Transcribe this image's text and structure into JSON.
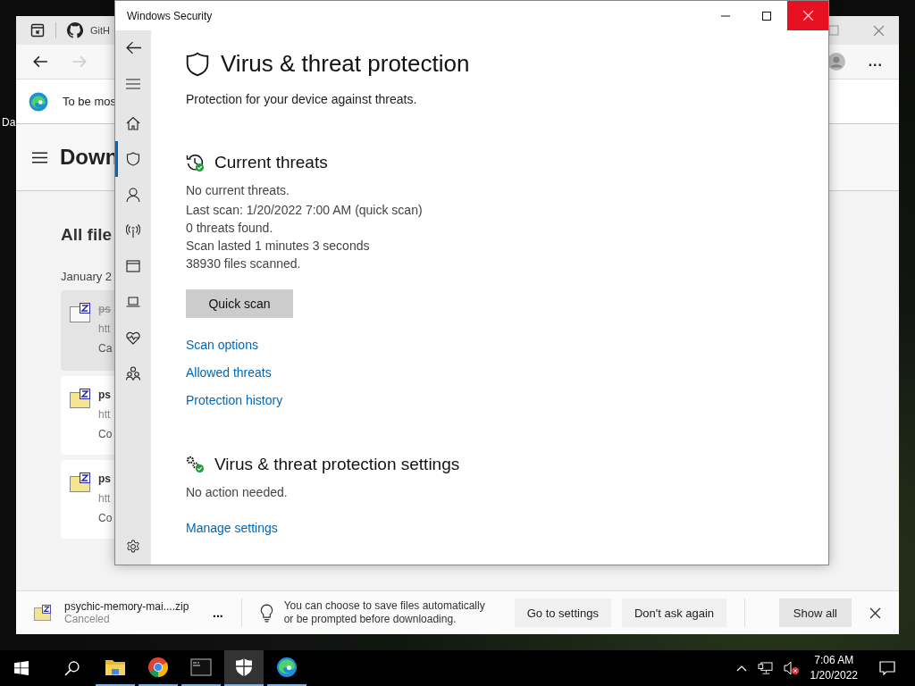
{
  "desktop": {
    "icon_label": "Da"
  },
  "browser": {
    "tab_title": "GitH",
    "more": "...",
    "info_text": "To be mos",
    "page_title": "Down",
    "section_title": "All file",
    "date_group": "January 2",
    "downloads": [
      {
        "name": "ps",
        "url": "htt",
        "status": "Ca",
        "selected": true,
        "canceled": true
      },
      {
        "name": "ps",
        "url": "htt",
        "status": "Co",
        "selected": false,
        "canceled": false
      },
      {
        "name": "ps",
        "url": "htt",
        "status": "Co",
        "selected": false,
        "canceled": false
      }
    ]
  },
  "download_bar": {
    "file": "psychic-memory-mai....zip",
    "status": "Canceled",
    "more": "...",
    "tip": "You can choose to save files automatically or be prompted before downloading.",
    "buttons": [
      "Go to settings",
      "Don't ask again"
    ],
    "show_all": "Show all"
  },
  "security": {
    "title": "Windows Security",
    "nav": [
      {
        "kind": "home",
        "selected": false
      },
      {
        "kind": "shield",
        "selected": true
      },
      {
        "kind": "account",
        "selected": false
      },
      {
        "kind": "network",
        "selected": false
      },
      {
        "kind": "app",
        "selected": false
      },
      {
        "kind": "device",
        "selected": false
      },
      {
        "kind": "health",
        "selected": false
      },
      {
        "kind": "family",
        "selected": false
      }
    ],
    "heading": "Virus & threat protection",
    "subtitle": "Protection for your device against threats.",
    "current_threats": {
      "title": "Current threats",
      "status": "No current threats.",
      "details": [
        "Last scan: 1/20/2022 7:00 AM (quick scan)",
        "0 threats found.",
        "Scan lasted 1 minutes 3 seconds",
        "38930 files scanned."
      ],
      "button": "Quick scan",
      "links": [
        "Scan options",
        "Allowed threats",
        "Protection history"
      ]
    },
    "settings": {
      "title": "Virus & threat protection settings",
      "status": "No action needed.",
      "link": "Manage settings"
    }
  },
  "taskbar": {
    "apps": [
      {
        "kind": "explorer",
        "running": true,
        "active": false
      },
      {
        "kind": "chrome",
        "running": true,
        "active": false
      },
      {
        "kind": "terminal",
        "running": true,
        "active": false
      },
      {
        "kind": "security",
        "running": true,
        "active": true
      },
      {
        "kind": "edge",
        "running": true,
        "active": false
      }
    ],
    "time": "7:06 AM",
    "date": "1/20/2022"
  }
}
